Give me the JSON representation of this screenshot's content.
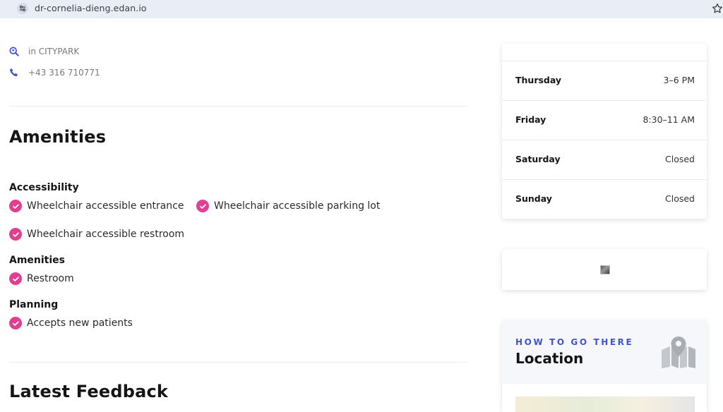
{
  "browser": {
    "url": "dr-cornelia-dieng.edan.io"
  },
  "contact": {
    "location": "in CITYPARK",
    "phone": "+43 316 710771"
  },
  "amenities_section": {
    "title": "Amenities",
    "groups": [
      {
        "title": "Accessibility",
        "items": [
          "Wheelchair accessible entrance",
          "Wheelchair accessible parking lot",
          "Wheelchair accessible restroom"
        ]
      },
      {
        "title": "Amenities",
        "items": [
          "Restroom"
        ]
      },
      {
        "title": "Planning",
        "items": [
          "Accepts new patients"
        ]
      }
    ]
  },
  "feedback_section": {
    "title": "Latest Feedback"
  },
  "opening_hours": [
    {
      "day": "Thursday",
      "time": "3–6 PM"
    },
    {
      "day": "Friday",
      "time": "8:30–11 AM"
    },
    {
      "day": "Saturday",
      "time": "Closed"
    },
    {
      "day": "Sunday",
      "time": "Closed"
    }
  ],
  "location_card": {
    "kicker": "HOW TO GO THERE",
    "title": "Location"
  },
  "colors": {
    "accent_pink": "#e0408f",
    "accent_blue": "#4053d6",
    "browser_bar": "#e9eef6"
  },
  "icons": {
    "site_info": "tune-icon",
    "bookmark": "star-icon",
    "location": "search-location-icon",
    "phone": "phone-icon",
    "check": "check-circle-icon",
    "map": "map-marker-icon"
  }
}
